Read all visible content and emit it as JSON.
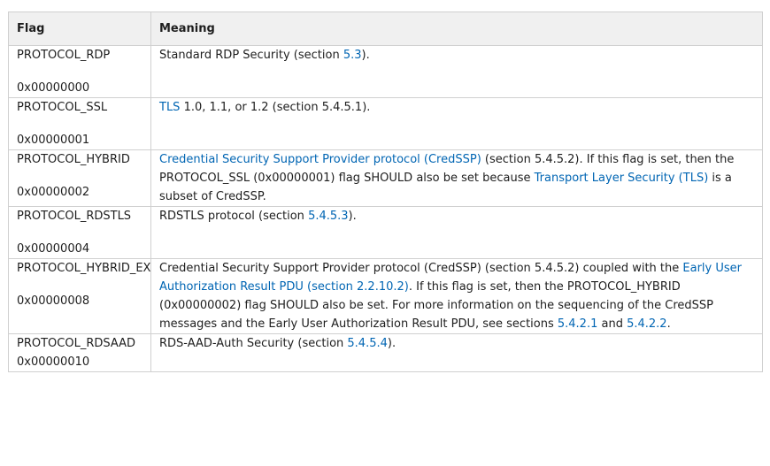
{
  "table": {
    "headers": [
      "Flag",
      "Meaning"
    ],
    "rows": [
      {
        "flag": "PROTOCOL_RDP",
        "value": "0x00000000",
        "m": [
          "Standard RDP Security (section ",
          "5.3",
          ")."
        ]
      },
      {
        "flag": "PROTOCOL_SSL",
        "value": "0x00000001",
        "m": [
          "TLS",
          " 1.0, 1.1, or 1.2 (section 5.4.5.1)."
        ]
      },
      {
        "flag": "PROTOCOL_HYBRID",
        "value": "0x00000002",
        "m": [
          "Credential Security Support Provider protocol (CredSSP)",
          " (section 5.4.5.2). If this flag is set, then the PROTOCOL_SSL (0x00000001) flag SHOULD also be set because ",
          "Transport Layer Security (TLS)",
          " is a subset of CredSSP."
        ]
      },
      {
        "flag": "PROTOCOL_RDSTLS",
        "value": "0x00000004",
        "m": [
          "RDSTLS protocol (section ",
          "5.4.5.3",
          ")."
        ]
      },
      {
        "flag": "PROTOCOL_HYBRID_EX",
        "value": "0x00000008",
        "m": [
          "Credential Security Support Provider protocol (CredSSP) (section 5.4.5.2) coupled with the ",
          "Early User Authorization Result PDU (section 2.2.10.2)",
          ". If this flag is set, then the PROTOCOL_HYBRID (0x00000002) flag SHOULD also be set. For more information on the sequencing of the CredSSP messages and the Early User Authorization Result PDU, see sections ",
          "5.4.2.1",
          " and ",
          "5.4.2.2",
          "."
        ]
      },
      {
        "flag": "PROTOCOL_RDSAAD",
        "value": "0x00000010",
        "m": [
          "RDS-AAD-Auth Security (section ",
          "5.4.5.4",
          ")."
        ]
      }
    ]
  }
}
